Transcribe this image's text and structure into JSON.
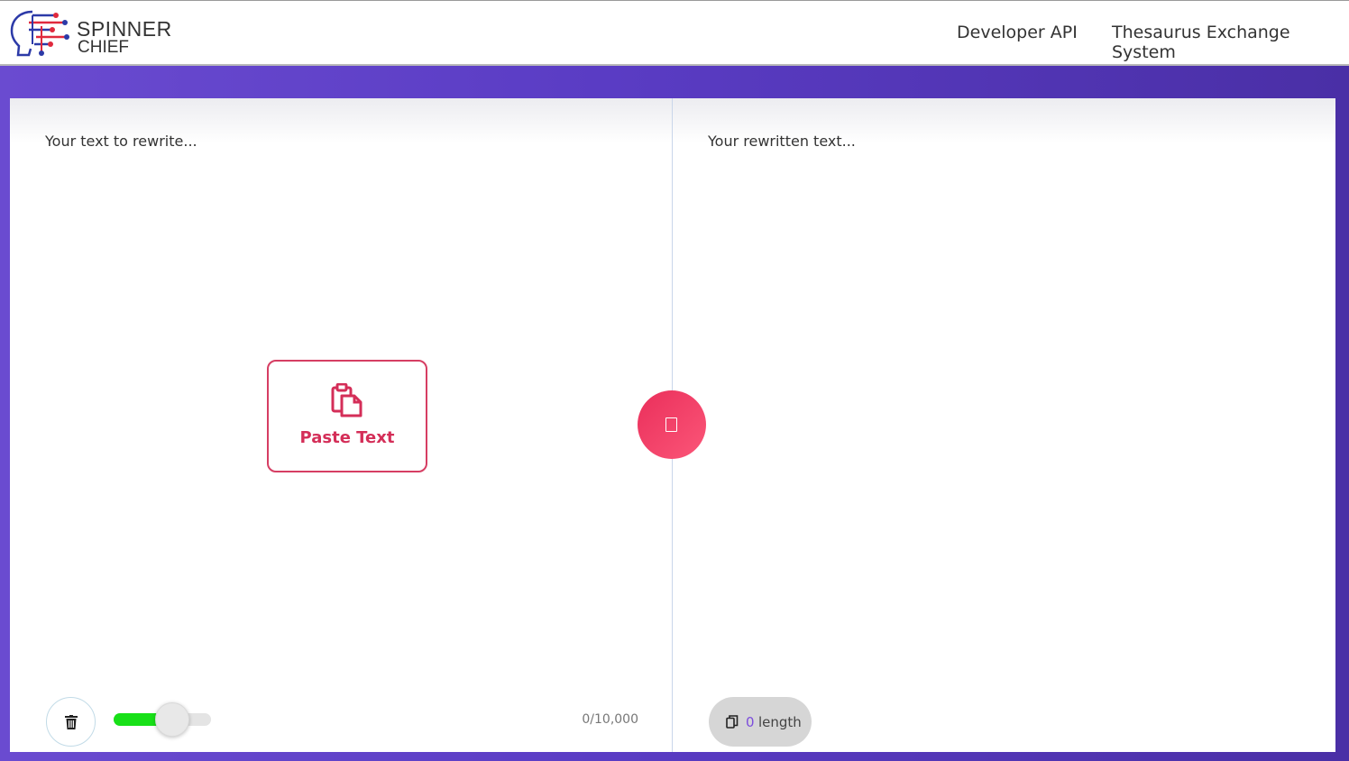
{
  "header": {
    "logo_line1": "SPINNER",
    "logo_line2": "CHIEF",
    "nav": {
      "developer_api": "Developer API",
      "thesaurus": "Thesaurus Exchange System"
    }
  },
  "editor": {
    "input_placeholder": "Your text to rewrite...",
    "output_placeholder": "Your rewritten text...",
    "paste_label": "Paste Text",
    "paste_icon": "clipboard-icon",
    "spin_icon": "square-glyph-icon",
    "char_counter": "0/10,000",
    "level_slider_fraction": 0.5,
    "output_length_value": "0",
    "output_length_unit": "length",
    "copy_icon": "copy-icon",
    "trash_icon": "trash-icon"
  },
  "colors": {
    "accent_red": "#d42e58",
    "background_purple": "#5a3cc4",
    "slider_green": "#18e018",
    "count_purple": "#7c4ddc"
  }
}
